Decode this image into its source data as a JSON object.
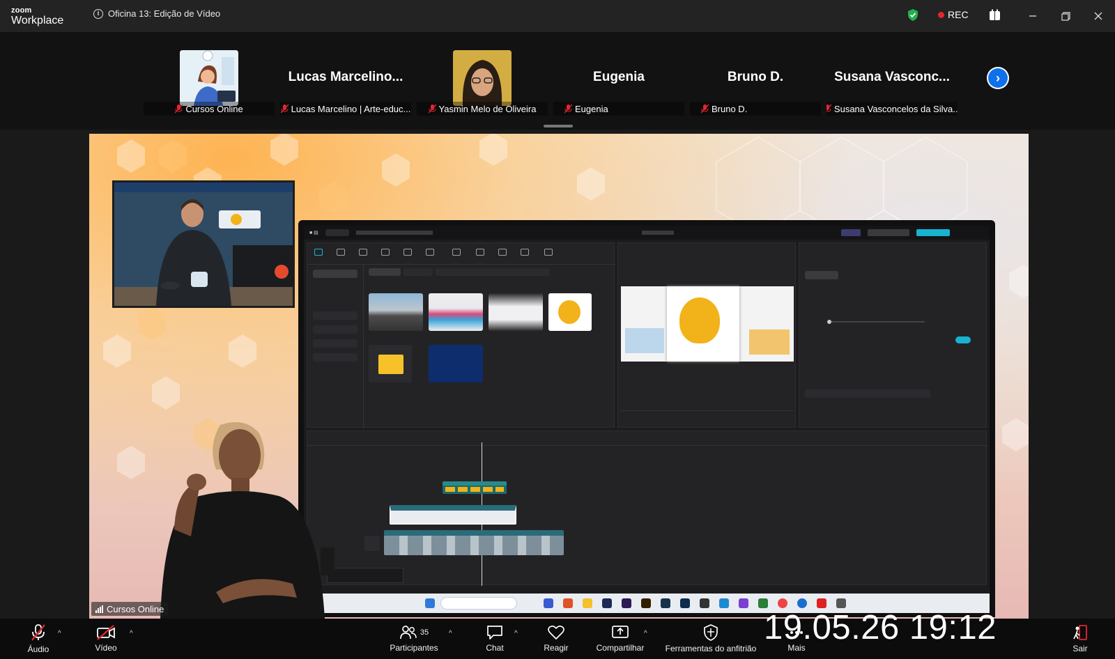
{
  "app": {
    "brand_small": "zoom",
    "brand_large": "Workplace"
  },
  "meeting": {
    "title": "Oficina 13: Edição de Vídeo"
  },
  "recording": {
    "label": "REC",
    "color": "#e5252f"
  },
  "accent_color": "#0e71eb",
  "participants_strip": [
    {
      "big_name": "",
      "label": "Cursos Online",
      "has_thumb": true
    },
    {
      "big_name": "Lucas  Marcelino...",
      "label": "Lucas Marcelino | Arte-educ...",
      "has_thumb": false
    },
    {
      "big_name": "",
      "label": "Yasmin Melo de Oliveira",
      "has_thumb": true
    },
    {
      "big_name": "Eugenia",
      "label": "Eugenia",
      "has_thumb": false
    },
    {
      "big_name": "Bruno D.",
      "label": "Bruno D.",
      "has_thumb": false
    },
    {
      "big_name": "Susana  Vasconc...",
      "label": "Susana Vasconcelos da Silva...",
      "has_thumb": false
    }
  ],
  "stage": {
    "speaker_label": "Cursos Online"
  },
  "toolbar": {
    "audio": "Áudio",
    "video": "Vídeo",
    "participants": "Participantes",
    "participants_count": "35",
    "chat": "Chat",
    "react": "Reagir",
    "share": "Compartilhar",
    "host_tools": "Ferramentas do anfitrião",
    "more": "Mais",
    "leave": "Sair"
  },
  "overlay": {
    "timestamp": "19.05.26 19:12"
  }
}
